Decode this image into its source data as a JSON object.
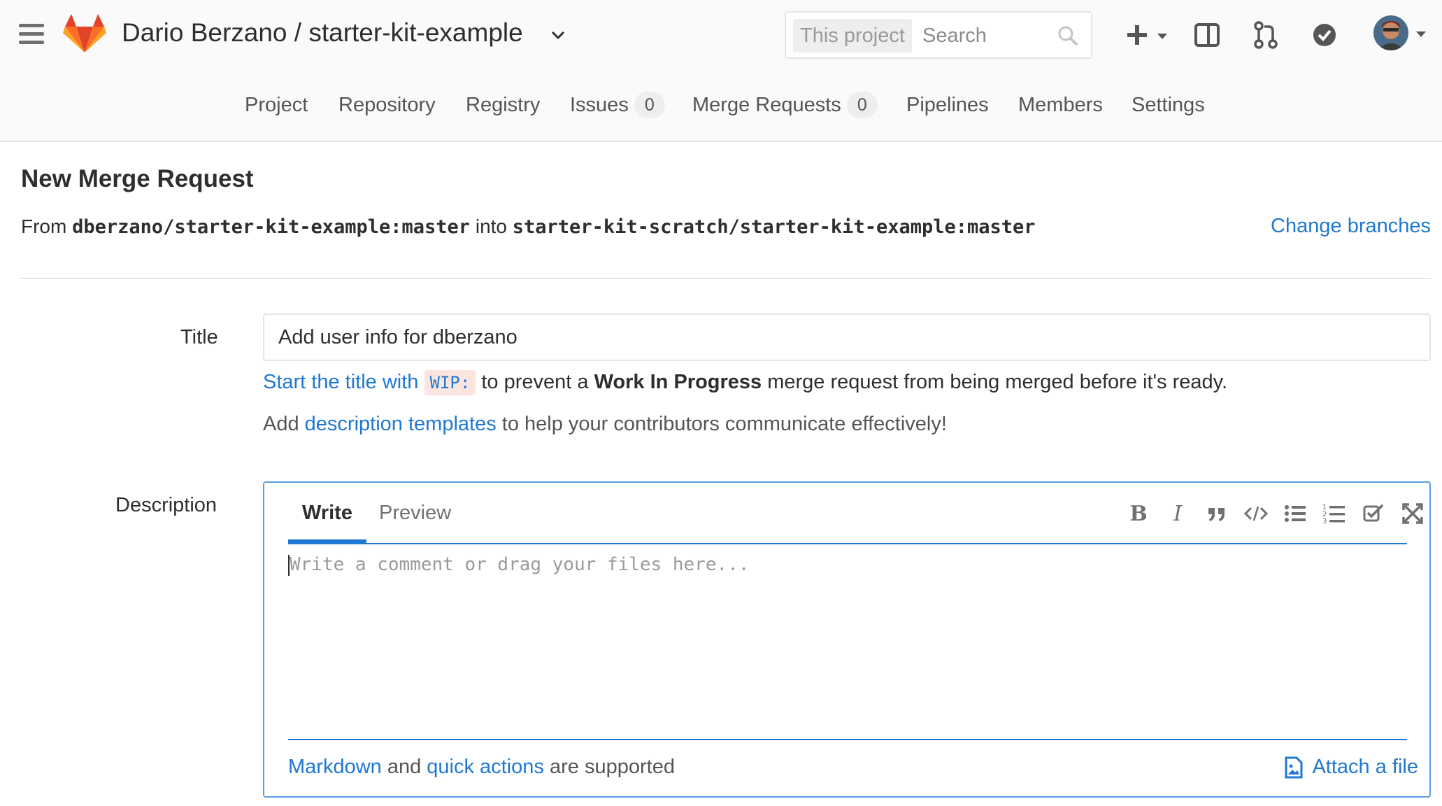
{
  "header": {
    "project_path": "Dario Berzano / starter-kit-example",
    "search": {
      "scope": "This project",
      "placeholder": "Search"
    }
  },
  "nav": {
    "items": [
      {
        "label": "Project"
      },
      {
        "label": "Repository"
      },
      {
        "label": "Registry"
      },
      {
        "label": "Issues",
        "count": "0"
      },
      {
        "label": "Merge Requests",
        "count": "0"
      },
      {
        "label": "Pipelines"
      },
      {
        "label": "Members"
      },
      {
        "label": "Settings"
      }
    ]
  },
  "page": {
    "heading": "New Merge Request",
    "from_word": "From",
    "source_branch": "dberzano/starter-kit-example:master",
    "into_word": "into",
    "target_branch": "starter-kit-scratch/starter-kit-example:master",
    "change_branches": "Change branches"
  },
  "form": {
    "title_label": "Title",
    "title_value": "Add user info for dberzano",
    "wip_hint": {
      "link": "Start the title with",
      "code": "WIP:",
      "middle": "to prevent a",
      "bold": "Work In Progress",
      "end": "merge request from being merged before it's ready."
    },
    "templates_hint": {
      "start": "Add",
      "link": "description templates",
      "end": "to help your contributors communicate effectively!"
    },
    "description_label": "Description",
    "editor": {
      "tab_write": "Write",
      "tab_preview": "Preview",
      "toolbar": [
        "bold-icon",
        "italic-icon",
        "quote-icon",
        "code-icon",
        "bullet-list-icon",
        "numbered-list-icon",
        "task-list-icon",
        "fullscreen-icon"
      ],
      "placeholder": "Write a comment or drag your files here...",
      "footer": {
        "markdown": "Markdown",
        "and": "and",
        "quick_actions": "quick actions",
        "supported": "are supported"
      },
      "attach": "Attach a file"
    }
  },
  "colors": {
    "link": "#1f78d1",
    "logo_orange": "#fc6d26",
    "logo_red": "#e24329",
    "logo_light": "#fca326"
  }
}
